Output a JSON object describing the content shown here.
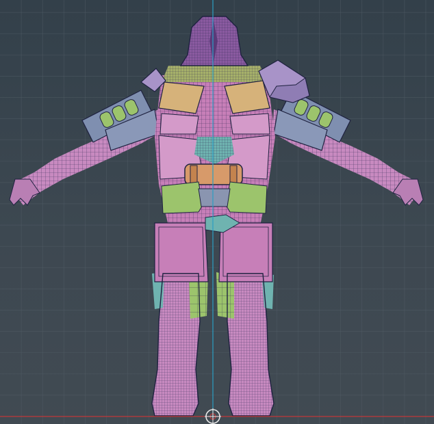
{
  "viewport": {
    "view": "front-orthographic",
    "background_color": "#3b4650",
    "grid_color": "#55606a",
    "axis_y_color": "#2b9fc4",
    "axis_x_color": "#c0383a",
    "wireframe_color": "#1f2240"
  },
  "model": {
    "colors": {
      "skin": "#c88ac0",
      "armor_pink": "#c77fb8",
      "armor_light": "#d49ac9",
      "armor_tan": "#d6b27a",
      "armor_green": "#9cc46c",
      "armor_teal": "#6fb3b0",
      "armor_lavender": "#a893c8",
      "armor_steel": "#7f8fb0",
      "cylinder": "#d79a6a",
      "head": "#8a5aa0"
    }
  },
  "manipulator": {
    "icon": "pivot-gizmo-icon"
  }
}
